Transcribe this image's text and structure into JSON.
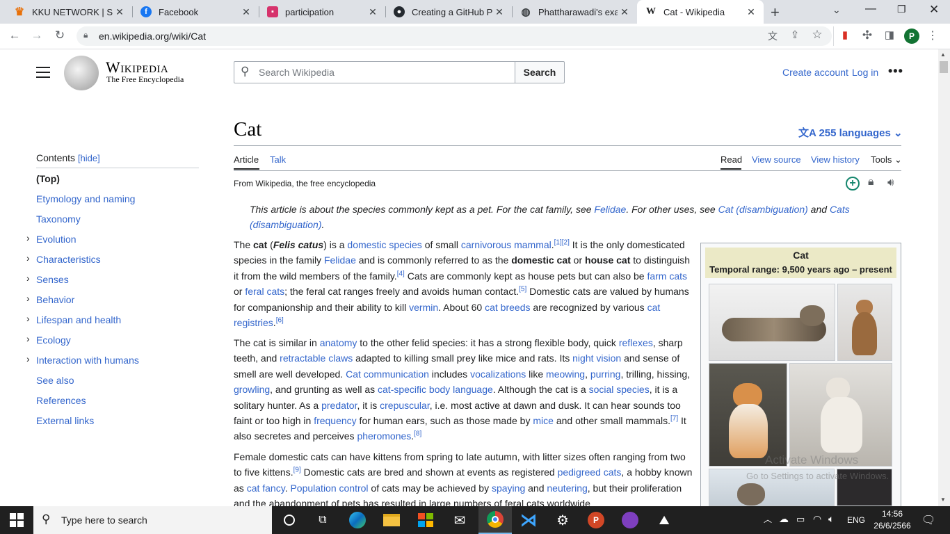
{
  "browser": {
    "tabs": [
      {
        "title": "KKU NETWORK | Statu",
        "icon": "kku-icon"
      },
      {
        "title": "Facebook",
        "icon": "facebook-icon"
      },
      {
        "title": "participation",
        "icon": "participation-icon"
      },
      {
        "title": "Creating a GitHub Pag",
        "icon": "github-icon"
      },
      {
        "title": "Phattharawadi's exam",
        "icon": "globe-icon"
      },
      {
        "title": "Cat - Wikipedia",
        "icon": "wikipedia-icon"
      }
    ],
    "url": "en.wikipedia.org/wiki/Cat",
    "profile_initial": "P"
  },
  "wiki": {
    "logo_title": "Wikipedia",
    "logo_subtitle": "The Free Encyclopedia",
    "search_placeholder": "Search Wikipedia",
    "search_button": "Search",
    "create_account": "Create account",
    "log_in": "Log in",
    "page_title": "Cat",
    "languages": "255 languages",
    "tabs": {
      "article": "Article",
      "talk": "Talk",
      "read": "Read",
      "view_source": "View source",
      "view_history": "View history",
      "tools": "Tools"
    },
    "tagline": "From Wikipedia, the free encyclopedia",
    "toc": {
      "heading": "Contents",
      "hide": "[hide]",
      "top": "(Top)",
      "items": [
        "Etymology and naming",
        "Taxonomy",
        "Evolution",
        "Characteristics",
        "Senses",
        "Behavior",
        "Lifespan and health",
        "Ecology",
        "Interaction with humans",
        "See also",
        "References",
        "External links"
      ]
    },
    "hatnote": {
      "t1": "This article is about the species commonly kept as a pet. For the cat family, see ",
      "l1": "Felidae",
      "t2": ". For other uses, see ",
      "l2": "Cat (disambiguation)",
      "t3": " and ",
      "l3": "Cats (disambiguation)",
      "t4": "."
    },
    "infobox": {
      "title": "Cat",
      "range": "Temporal range: 9,500 years ago – present"
    },
    "watermark": {
      "line1": "Activate Windows",
      "line2": "Go to Settings to activate Windows."
    }
  },
  "taskbar": {
    "search_placeholder": "Type here to search",
    "lang": "ENG",
    "time": "14:56",
    "date": "26/6/2566"
  }
}
